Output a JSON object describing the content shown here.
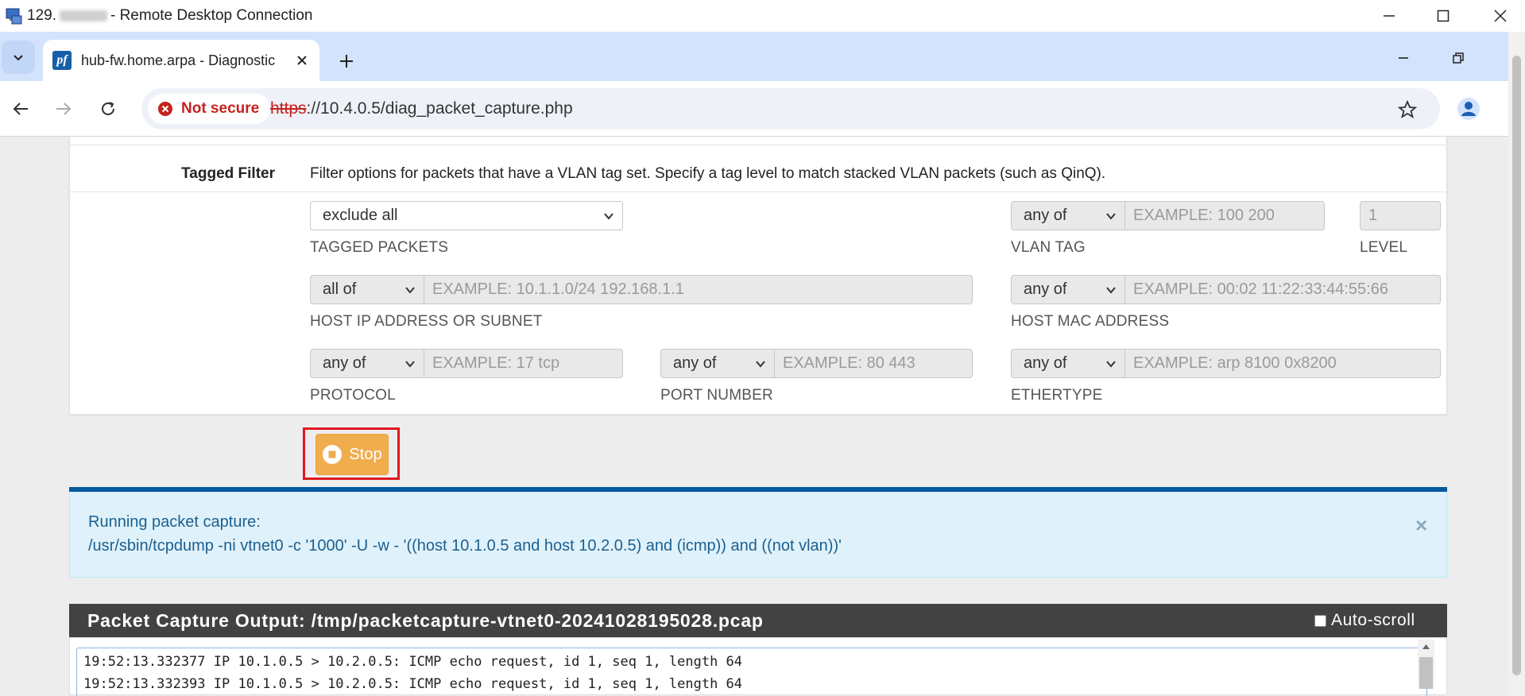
{
  "window": {
    "title_prefix": "129.",
    "title_suffix": "- Remote Desktop Connection"
  },
  "browser": {
    "tab_title": "hub-fw.home.arpa - Diagnostic",
    "tab_favicon": "pf",
    "security_label": "Not secure",
    "url_scheme": "https",
    "url_rest": "://10.4.0.5/diag_packet_capture.php"
  },
  "form": {
    "tagged_filter_label": "Tagged Filter",
    "tagged_filter_help": "Filter options for packets that have a VLAN tag set. Specify a tag level to match stacked VLAN packets (such as QinQ).",
    "tagged_packets": {
      "value": "exclude all",
      "label": "TAGGED PACKETS"
    },
    "vlan_tag": {
      "mode": "any of",
      "placeholder": "EXAMPLE: 100 200",
      "label": "VLAN TAG"
    },
    "level": {
      "placeholder": "1",
      "label": "LEVEL"
    },
    "host_ip": {
      "mode": "all of",
      "placeholder": "EXAMPLE: 10.1.1.0/24 192.168.1.1",
      "label": "HOST IP ADDRESS OR SUBNET"
    },
    "host_mac": {
      "mode": "any of",
      "placeholder": "EXAMPLE: 00:02 11:22:33:44:55:66",
      "label": "HOST MAC ADDRESS"
    },
    "protocol": {
      "mode": "any of",
      "placeholder": "EXAMPLE: 17 tcp",
      "label": "PROTOCOL"
    },
    "port": {
      "mode": "any of",
      "placeholder": "EXAMPLE: 80 443",
      "label": "PORT NUMBER"
    },
    "ethertype": {
      "mode": "any of",
      "placeholder": "EXAMPLE: arp 8100 0x8200",
      "label": "ETHERTYPE"
    }
  },
  "stop_button": {
    "label": "Stop",
    "color": "#f0ad4e"
  },
  "alert": {
    "line1": "Running packet capture:",
    "line2": "/usr/sbin/tcpdump -ni vtnet0 -c '1000' -U -w - '((host 10.1.0.5 and host 10.2.0.5) and (icmp)) and ((not vlan))'",
    "close": "×"
  },
  "output": {
    "title": "Packet Capture Output: /tmp/packetcapture-vtnet0-20241028195028.pcap",
    "autoscroll_label": "Auto-scroll",
    "autoscroll_checked": false,
    "lines": [
      "19:52:13.332377 IP 10.1.0.5 > 10.2.0.5: ICMP echo request, id 1, seq 1, length 64",
      "19:52:13.332393 IP 10.1.0.5 > 10.2.0.5: ICMP echo request, id 1, seq 1, length 64"
    ]
  },
  "colors": {
    "accent_blue": "#035a9f",
    "alert_bg": "#dff2fb",
    "warning_orange": "#f0ad4e",
    "highlight_red": "#e0171f"
  }
}
